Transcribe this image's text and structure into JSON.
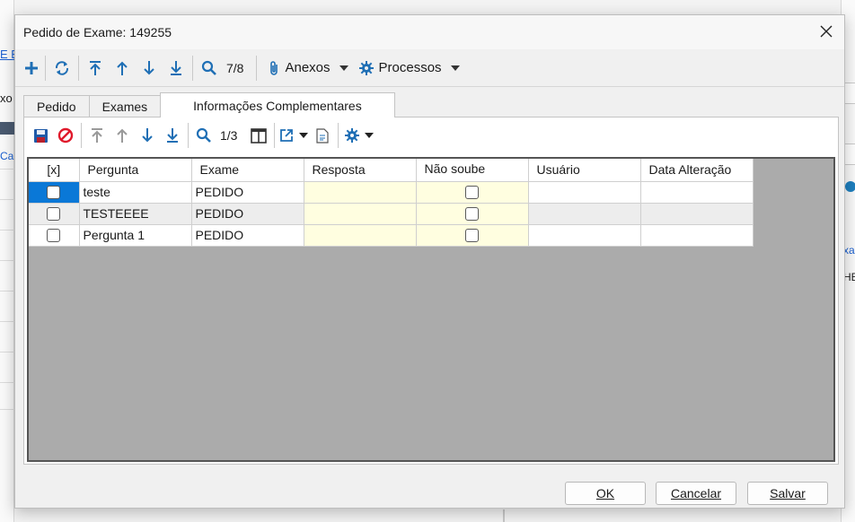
{
  "dialog": {
    "title": "Pedido de Exame: 149255",
    "close_glyph": "✕"
  },
  "background": {
    "left_fragments": [
      "E E",
      "xo",
      "Ca"
    ],
    "right_fragments": [
      "xa",
      "HE"
    ]
  },
  "toolbar1": {
    "record_position": "7/8",
    "anexos_label": "Anexos",
    "processos_label": "Processos"
  },
  "tabs": [
    {
      "label": "Pedido"
    },
    {
      "label": "Exames"
    },
    {
      "label": "Informações Complementares",
      "active": true
    }
  ],
  "toolbar2": {
    "record_position": "1/3"
  },
  "grid": {
    "columns": [
      "[x]",
      "Pergunta",
      "Exame",
      "Resposta",
      "Não soube",
      "Usuário",
      "Data Alteração"
    ],
    "rows": [
      {
        "pergunta": "teste",
        "exame": "PEDIDO",
        "resposta": "",
        "usuario": "",
        "data_alteracao": "",
        "selected": true
      },
      {
        "pergunta": "TESTEEEE",
        "exame": "PEDIDO",
        "resposta": "",
        "usuario": "",
        "data_alteracao": ""
      },
      {
        "pergunta": "Pergunta 1",
        "exame": "PEDIDO",
        "resposta": "",
        "usuario": "",
        "data_alteracao": ""
      }
    ]
  },
  "footer": {
    "ok_label": "OK",
    "cancel_label": "Cancelar",
    "save_label": "Salvar"
  },
  "colors": {
    "accent": "#1f6fb5",
    "selection": "#0a78d7",
    "cancel_red": "#e0192b",
    "editable_yellow": "#fffee0",
    "grid_background": "#ababab"
  },
  "icons": [
    "plus-icon",
    "refresh-icon",
    "first-record-icon",
    "previous-record-icon",
    "next-record-icon",
    "last-record-icon",
    "search-icon",
    "paperclip-icon",
    "gear-icon",
    "save-disk-icon",
    "cancel-icon",
    "columns-icon",
    "export-icon",
    "document-icon",
    "close-icon"
  ]
}
